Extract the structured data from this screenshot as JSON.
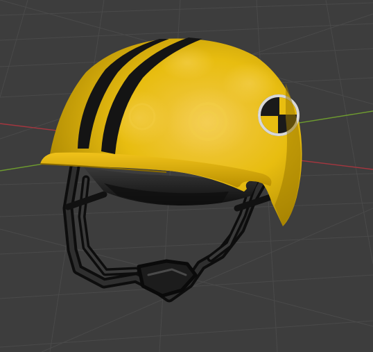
{
  "viewport": {
    "background_color": "#3d3d3d",
    "grid_color": "#4a4a4a",
    "x_axis_color": "#a5363f",
    "y_axis_color": "#6e9b2f"
  },
  "model": {
    "shell_color": "#e8bd10",
    "shell_shadow_color": "#9c7a00",
    "stripe_color": "#141414",
    "strap_color": "#1c1c1c",
    "logo_icon": "crash-test-dummy-icon"
  }
}
